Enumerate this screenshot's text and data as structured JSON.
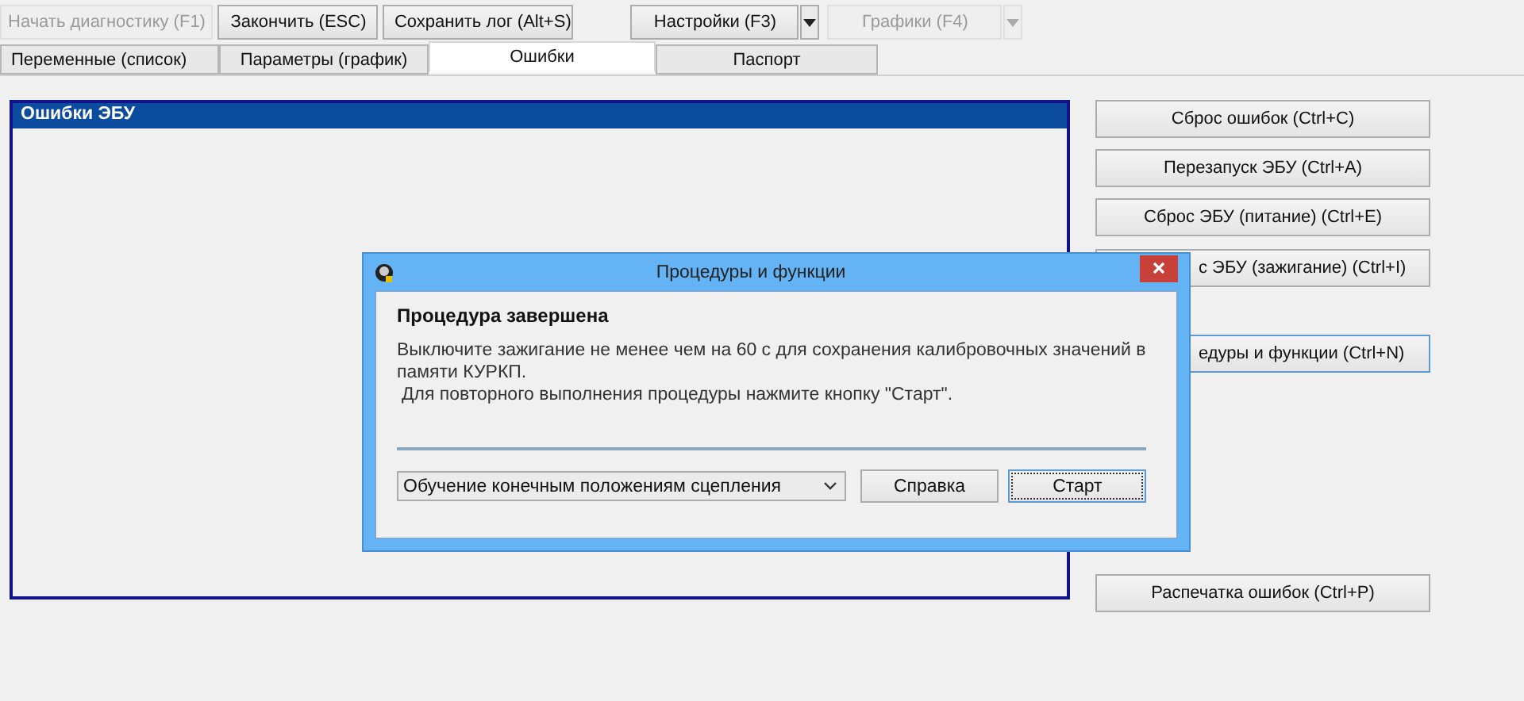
{
  "toolbar": [
    {
      "label": "Начать диагностику (F1)",
      "disabled": true,
      "dropdown": false
    },
    {
      "label": "Закончить (ESC)",
      "disabled": false,
      "dropdown": false
    },
    {
      "label": "Сохранить лог (Alt+S)",
      "disabled": false,
      "dropdown": false
    },
    {
      "label": "Настройки (F3)",
      "disabled": false,
      "dropdown": true
    },
    {
      "label": "Графики (F4)",
      "disabled": true,
      "dropdown": true
    }
  ],
  "tabs": [
    {
      "label": "Переменные (список)",
      "selected": false
    },
    {
      "label": "Параметры (график)",
      "selected": false
    },
    {
      "label": "Ошибки",
      "selected": true
    },
    {
      "label": "Паспорт",
      "selected": false
    }
  ],
  "errors_panel": {
    "title": "Ошибки ЭБУ"
  },
  "side_buttons": [
    {
      "label": "Сброс ошибок (Ctrl+C)",
      "focused": false,
      "covered": false
    },
    {
      "label": "Перезапуск ЭБУ (Ctrl+A)",
      "focused": false,
      "covered": false
    },
    {
      "label": "Сброс ЭБУ (питание) (Ctrl+E)",
      "focused": false,
      "covered": false
    },
    {
      "label": "с ЭБУ (зажигание) (Ctrl+I)",
      "focused": false,
      "covered": true
    },
    {
      "label": "едуры и функции (Ctrl+N)",
      "focused": true,
      "covered": true
    },
    {
      "label": "Распечатка ошибок (Ctrl+P)",
      "focused": false,
      "covered": false
    }
  ],
  "dialog": {
    "title": "Процедуры и функции",
    "heading": "Процедура завершена",
    "message": [
      "Выключите зажигание не менее чем на 60 с для сохранения калибровочных значений в памяти КУРКП.",
      "Для повторного выполнения процедуры нажмите кнопку \"Старт\"."
    ],
    "procedure": "Обучение конечным положениям сцепления",
    "buttons": [
      {
        "label": "Справка",
        "focused": false
      },
      {
        "label": "Старт",
        "focused": true
      }
    ]
  }
}
